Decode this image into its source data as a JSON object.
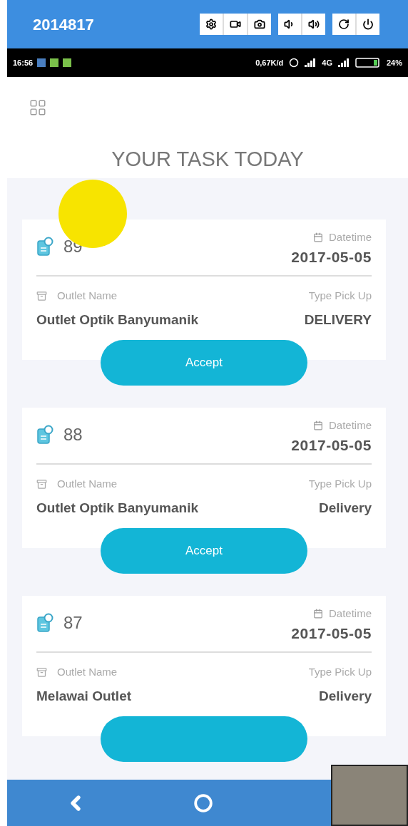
{
  "recorder_bar": {
    "title": "2014817"
  },
  "status_bar": {
    "time": "16:56",
    "speed": "0,67K/d",
    "network": "4G",
    "battery": "24%"
  },
  "header": {
    "title": "YOUR TASK TODAY"
  },
  "tasks": [
    {
      "number": "89",
      "datetime_label": "Datetime",
      "datetime": "2017-05-05",
      "outlet_label": "Outlet Name",
      "outlet": "Outlet Optik Banyumanik",
      "type_label": "Type Pick Up",
      "type": "DELIVERY",
      "button": "Accept"
    },
    {
      "number": "88",
      "datetime_label": "Datetime",
      "datetime": "2017-05-05",
      "outlet_label": "Outlet Name",
      "outlet": "Outlet Optik Banyumanik",
      "type_label": "Type Pick Up",
      "type": "Delivery",
      "button": "Accept"
    },
    {
      "number": "87",
      "datetime_label": "Datetime",
      "datetime": "2017-05-05",
      "outlet_label": "Outlet Name",
      "outlet": "Melawai Outlet",
      "type_label": "Type Pick Up",
      "type": "Delivery"
    }
  ]
}
